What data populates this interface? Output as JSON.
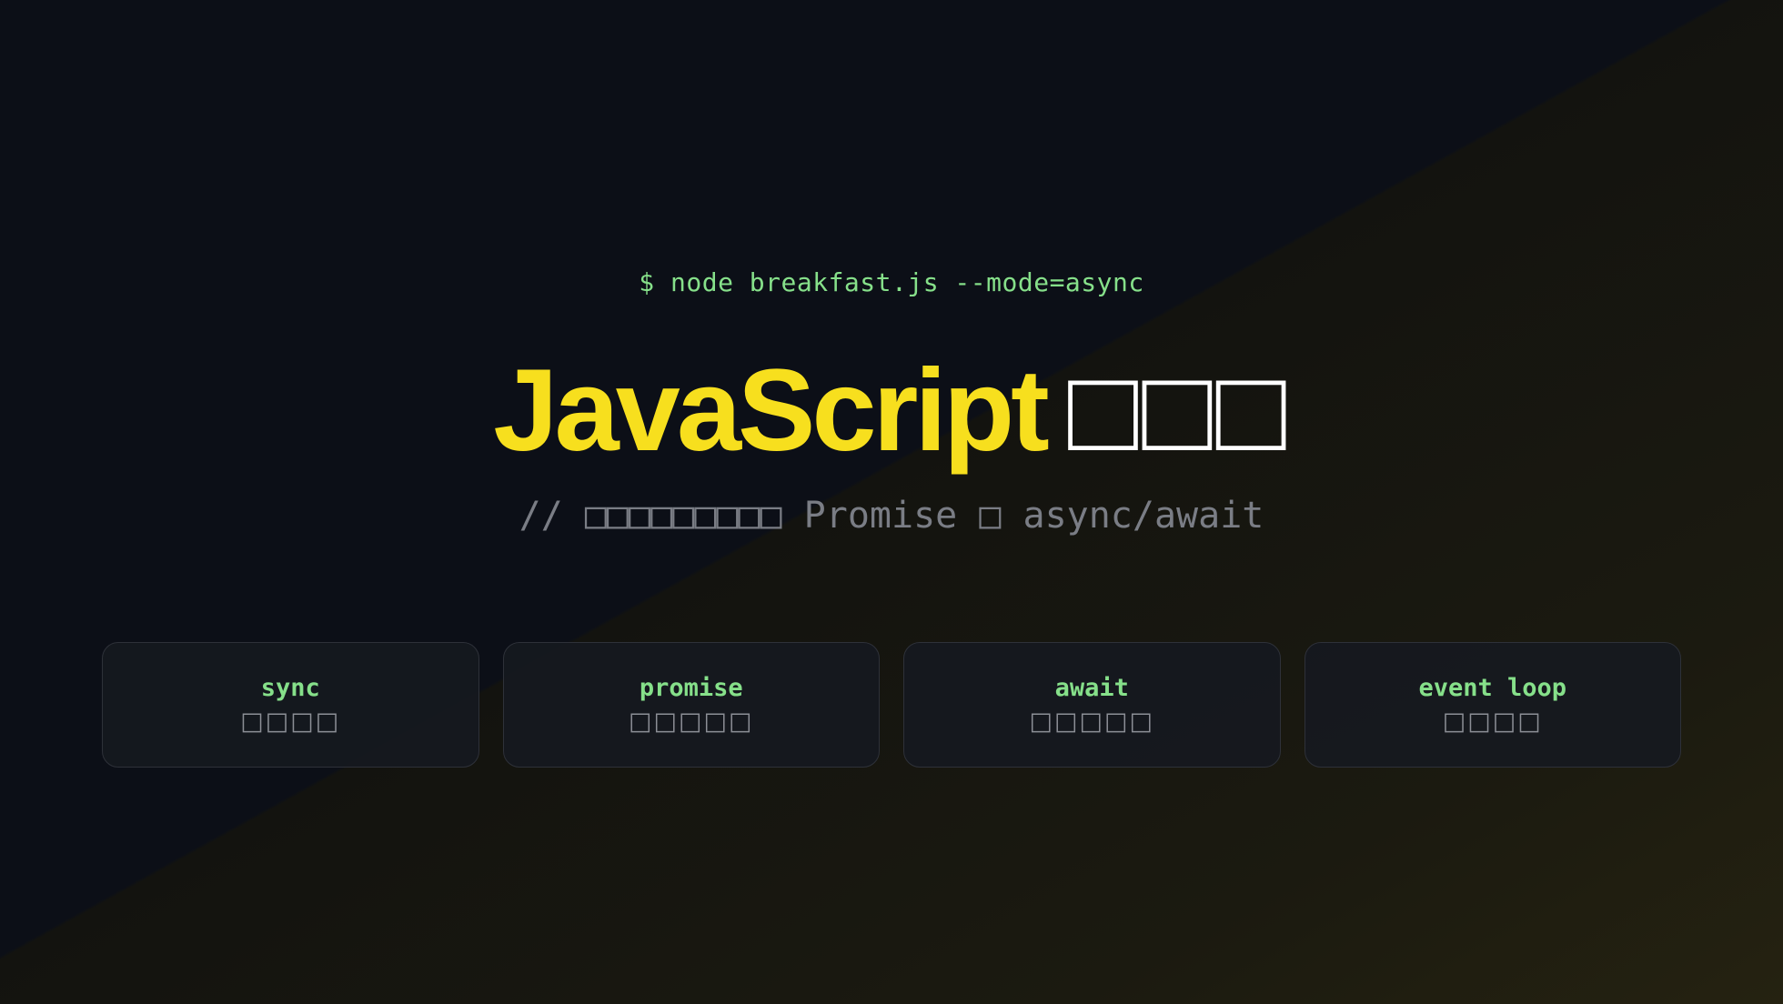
{
  "terminal": {
    "prompt": "$ node breakfast.js --mode=async"
  },
  "hero": {
    "title_highlight": "JavaScript",
    "title_rest": "□□□",
    "subtitle": "// □□□□□□□□□ Promise □ async/await"
  },
  "cards": [
    {
      "label": "sync",
      "desc": "□□□□"
    },
    {
      "label": "promise",
      "desc": "□□□□□"
    },
    {
      "label": "await",
      "desc": "□□□□□"
    },
    {
      "label": "event loop",
      "desc": "□□□□"
    }
  ],
  "colors": {
    "background": "#0c0f17",
    "accent_yellow": "#f7df1e",
    "terminal_green": "#86e08a",
    "muted_gray": "#7a7d85",
    "card_border": "#2e3139"
  }
}
